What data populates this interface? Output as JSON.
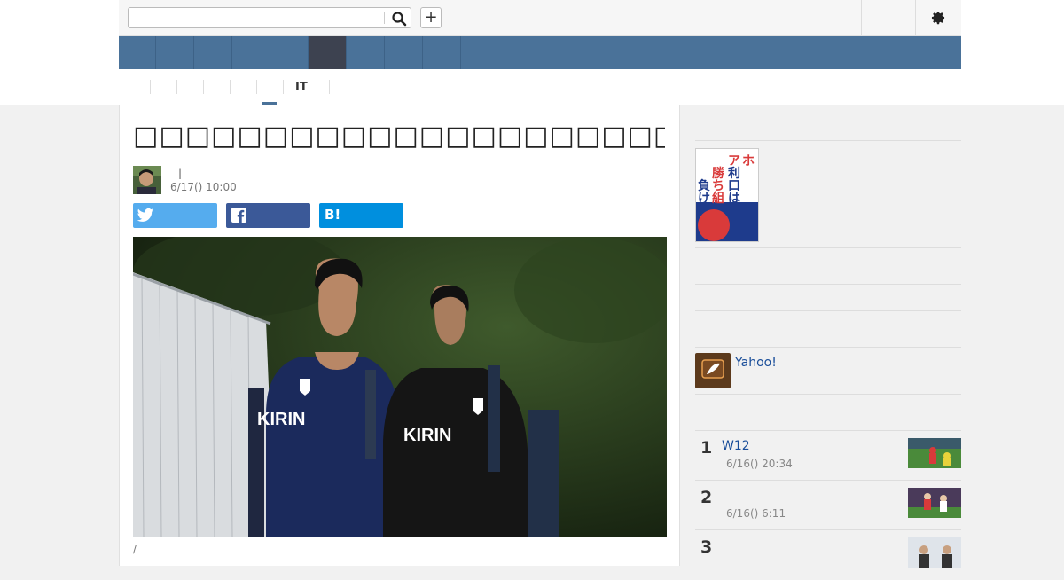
{
  "search": {
    "placeholder": "",
    "value": ""
  },
  "subnav": {
    "active_label": "IT"
  },
  "article": {
    "title": "□□□□□□□□□□□□□□□□□□□□□□□□□□□□□□□□□□□□□□□□□",
    "author_separator": "|",
    "date": "6/17() 10:00",
    "share": {
      "twitter_icon": "twitter-bird-icon",
      "facebook_icon": "facebook-f-icon",
      "hatena_label": "B!"
    },
    "photo": {
      "shirt_text_left": "KIRIN",
      "shirt_text_right": "KIRIN"
    },
    "caption": "/"
  },
  "sidebar": {
    "book_cover_text": "アホが勝ち組 利口は負け組",
    "yahoo_label": "Yahoo!",
    "ranking": [
      {
        "rank": "1",
        "title": "W12",
        "date": "6/16() 20:34"
      },
      {
        "rank": "2",
        "title": "",
        "date": "6/16() 6:11"
      },
      {
        "rank": "3",
        "title": "",
        "date": ""
      }
    ]
  },
  "colors": {
    "nav": "#4a7299",
    "nav_active": "#3d4250",
    "twitter": "#55acee",
    "facebook": "#3b5998",
    "hatena": "#008fde",
    "link": "#1a4e9a"
  }
}
